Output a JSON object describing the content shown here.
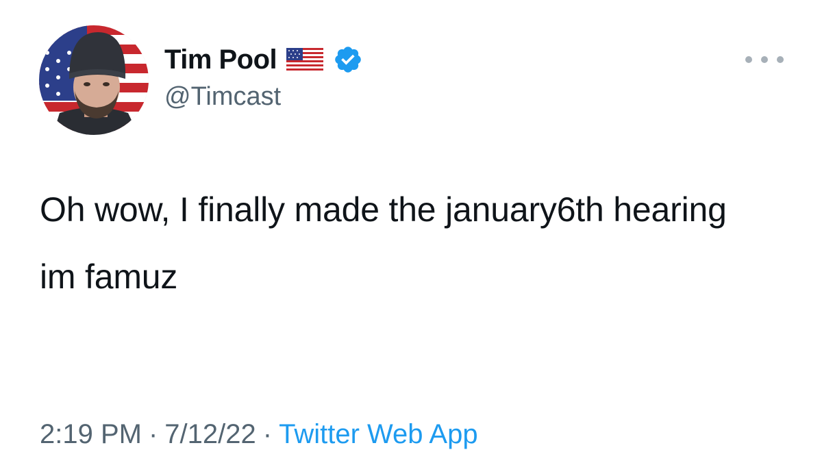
{
  "author": {
    "display_name": "Tim Pool",
    "handle": "@Timcast",
    "flag_icon": "us-flag-icon",
    "verified_icon": "verified-badge-icon"
  },
  "menu": {
    "icon": "more-horizontal-icon"
  },
  "tweet": {
    "paragraphs": [
      "Oh wow, I finally made the january6th hearing",
      "im famuz"
    ]
  },
  "meta": {
    "time": "2:19 PM",
    "separator": "·",
    "date": "7/12/22",
    "source": "Twitter Web App"
  },
  "colors": {
    "text": "#0f1419",
    "secondary": "#536471",
    "link": "#1d9bf0",
    "verified": "#1d9bf0"
  }
}
